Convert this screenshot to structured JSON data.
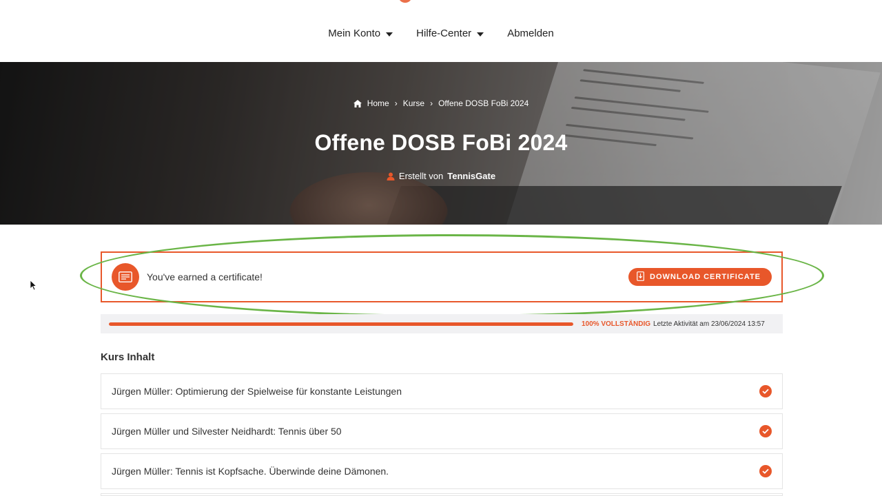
{
  "nav": {
    "menu": [
      {
        "label": "Mein Konto",
        "dropdown": true
      },
      {
        "label": "Hilfe-Center",
        "dropdown": true
      },
      {
        "label": "Abmelden",
        "dropdown": false
      }
    ]
  },
  "hero": {
    "breadcrumb": [
      "Home",
      "Kurse",
      "Offene DOSB FoBi 2024"
    ],
    "title": "Offene DOSB FoBi 2024",
    "author_prefix": "Erstellt von",
    "author_name": "TennisGate"
  },
  "certificate": {
    "message": "You've earned a certificate!",
    "button_label": "DOWNLOAD CERTIFICATE"
  },
  "progress": {
    "percent": 100,
    "percent_label": "100% VOLLSTÄNDIG",
    "last_activity": "Letzte Aktivität am 23/06/2024 13:57"
  },
  "course": {
    "section_title": "Kurs Inhalt",
    "lessons": [
      {
        "title": "Jürgen Müller: Optimierung der Spielweise für konstante Leistungen",
        "completed": true
      },
      {
        "title": "Jürgen Müller und Silvester Neidhardt: Tennis über 50",
        "completed": true
      },
      {
        "title": "Jürgen Müller: Tennis ist Kopfsache. Überwinde deine Dämonen.",
        "completed": true
      }
    ]
  },
  "colors": {
    "accent": "#e8572a",
    "highlight_ring": "#6ab547"
  },
  "icons": {
    "breadcrumb_home": "home-icon",
    "author": "user-icon",
    "certificate": "certificate-icon",
    "download": "download-icon",
    "lesson_status": "check-circle-icon"
  }
}
